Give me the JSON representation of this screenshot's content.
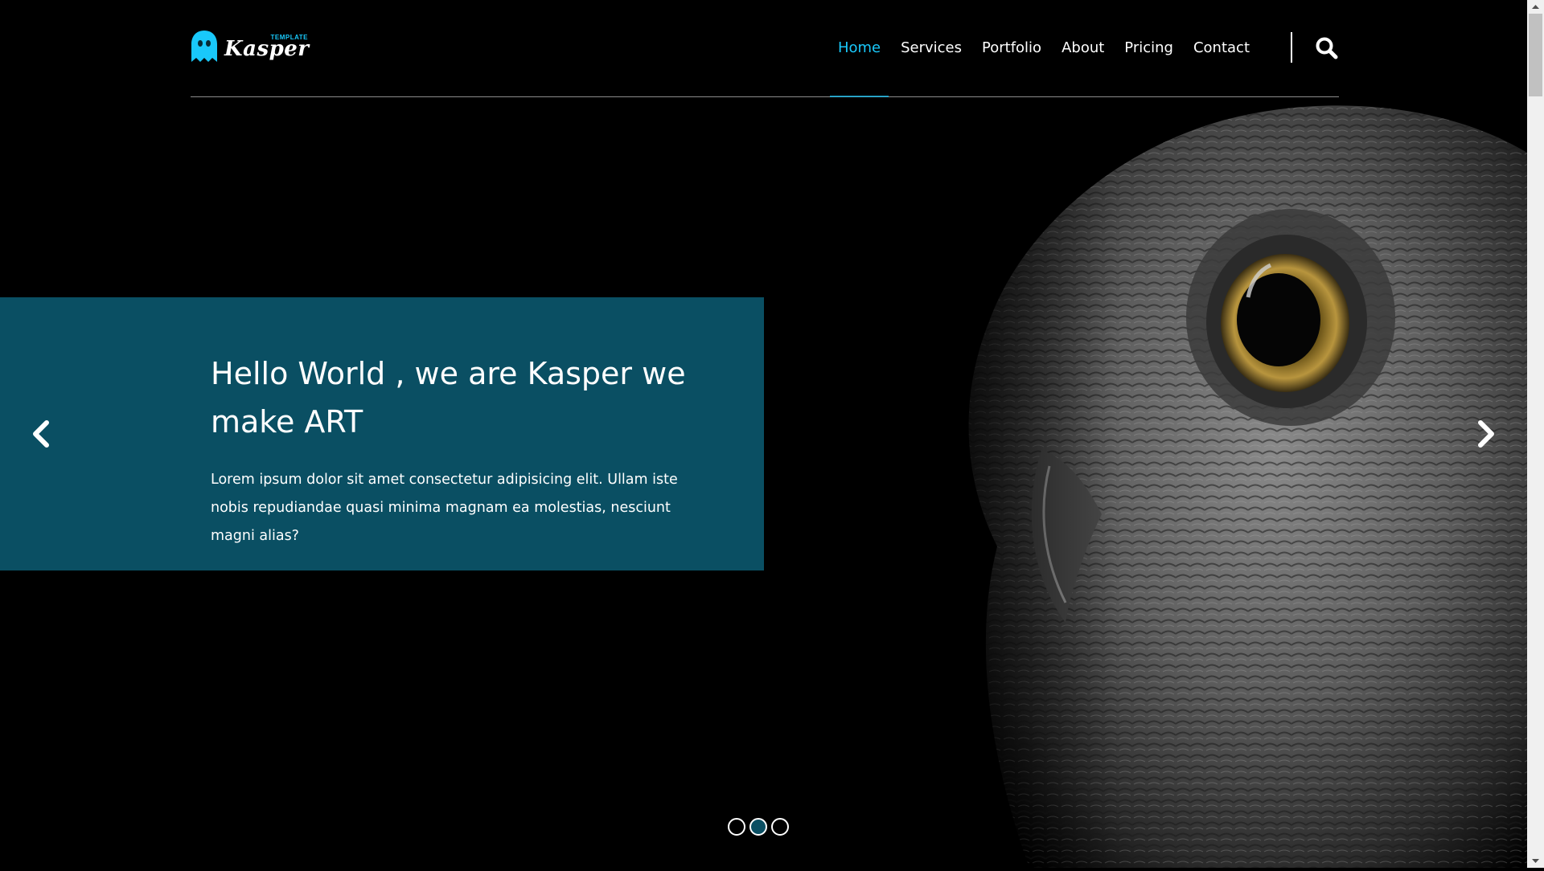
{
  "brand": {
    "name": "Kasper",
    "tagline": "TEMPLATE",
    "logo_icon": "ghost-icon",
    "accent_color": "#19c8fa"
  },
  "nav": {
    "items": [
      {
        "label": "Home",
        "active": true
      },
      {
        "label": "Services",
        "active": false
      },
      {
        "label": "Portfolio",
        "active": false
      },
      {
        "label": "About",
        "active": false
      },
      {
        "label": "Pricing",
        "active": false
      },
      {
        "label": "Contact",
        "active": false
      }
    ],
    "search_icon": "search-icon"
  },
  "hero": {
    "title": "Hello World , we are Kasper we make ART",
    "text": "Lorem ipsum dolor sit amet consectetur adipisicing elit. Ullam iste nobis repudiandae quasi minima magnam ea molestias, nesciunt magni alias?",
    "box_color": "#0a4f63",
    "prev_icon": "chevron-left-icon",
    "next_icon": "chevron-right-icon",
    "background_image": "owl-photo",
    "bullets": [
      {
        "active": false
      },
      {
        "active": true
      },
      {
        "active": false
      }
    ]
  },
  "colors": {
    "background": "#000000",
    "text": "#ffffff",
    "active_nav": "#19c8fa"
  }
}
